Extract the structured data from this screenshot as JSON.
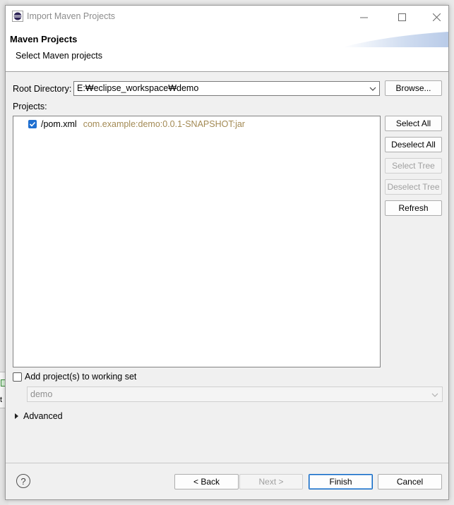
{
  "window": {
    "title": "Import Maven Projects",
    "controls": {
      "minimize": "—",
      "maximize": "☐",
      "close": "✕"
    }
  },
  "header": {
    "title": "Maven Projects",
    "subtitle": "Select Maven projects"
  },
  "root_directory": {
    "label": "Root Directory:",
    "value": "E:₩eclipse_workspace₩demo",
    "browse_label": "Browse..."
  },
  "projects": {
    "label": "Projects:",
    "items": [
      {
        "name": "/pom.xml",
        "id": "com.example:demo:0.0.1-SNAPSHOT:jar",
        "checked": true
      }
    ],
    "buttons": {
      "select_all": "Select All",
      "deselect_all": "Deselect All",
      "select_tree": "Select Tree",
      "deselect_tree": "Deselect Tree",
      "refresh": "Refresh"
    }
  },
  "working_set": {
    "label": "Add project(s) to working set",
    "checked": false,
    "value": "demo"
  },
  "advanced": {
    "label": "Advanced"
  },
  "footer": {
    "help": "?",
    "back": "< Back",
    "next": "Next >",
    "finish": "Finish",
    "cancel": "Cancel"
  },
  "colors": {
    "accent": "#1f6fd0",
    "artifact_text": "#a38a54",
    "disabled_text": "#a0a0a0"
  }
}
